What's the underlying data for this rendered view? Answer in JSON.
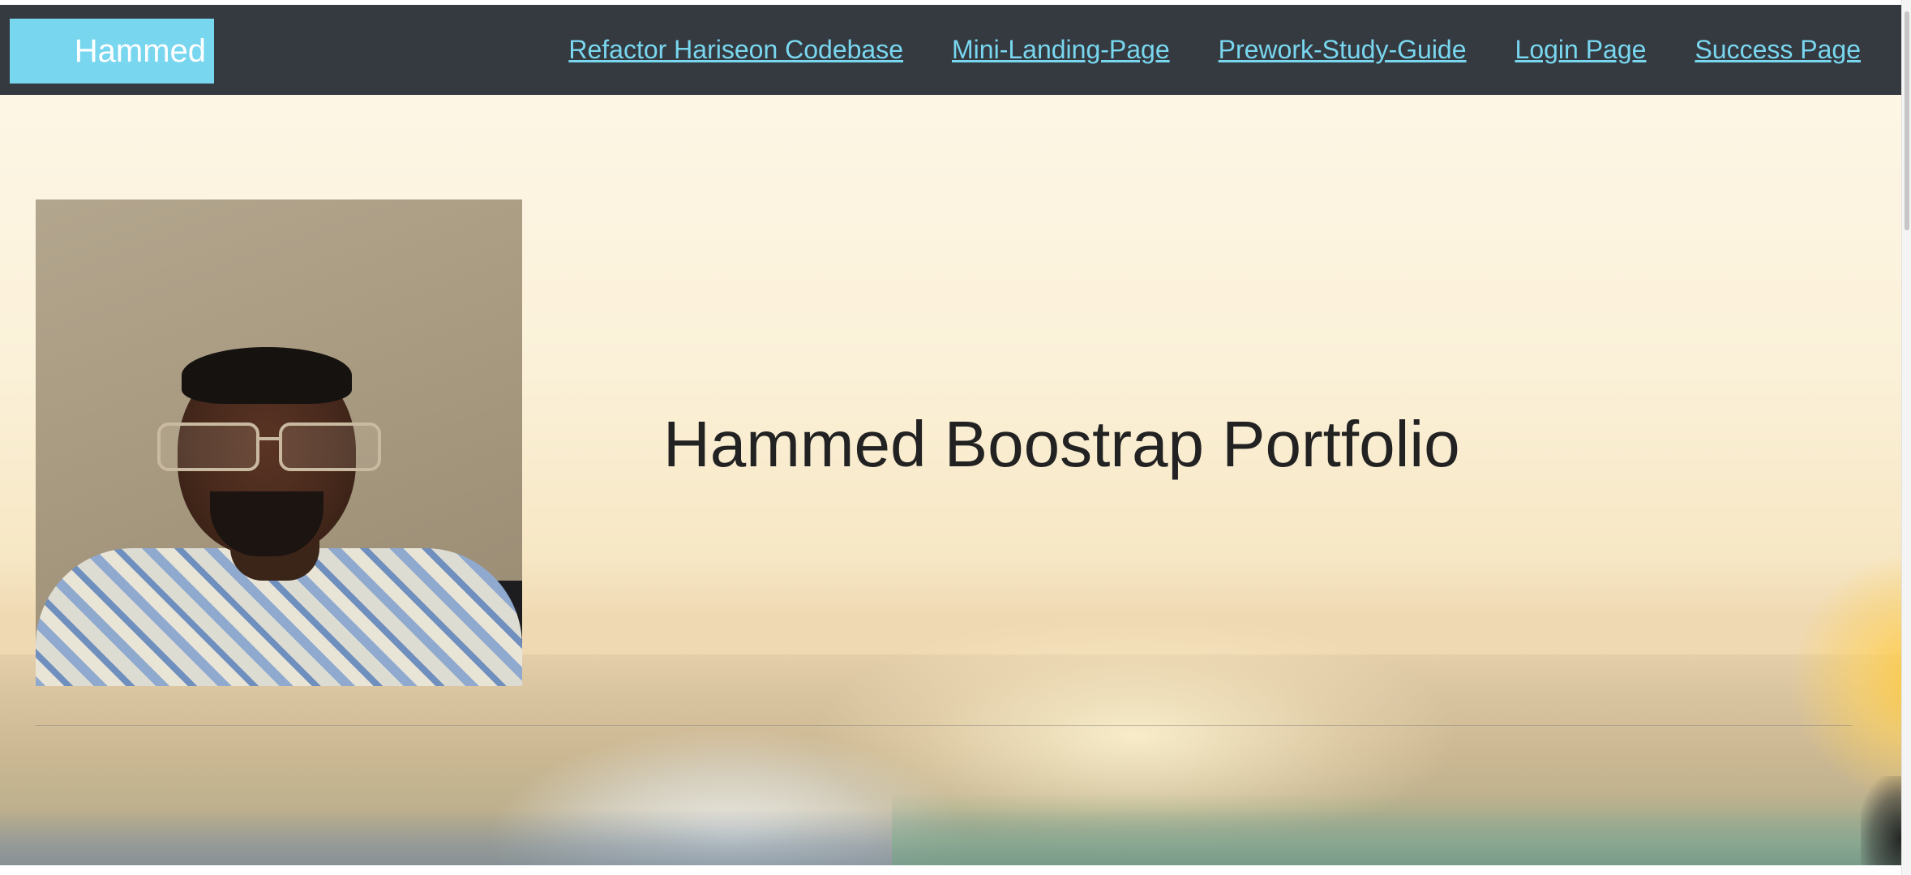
{
  "navbar": {
    "brand": "Hammed",
    "links": [
      {
        "label": "Refactor Hariseon Codebase"
      },
      {
        "label": "Mini-Landing-Page"
      },
      {
        "label": "Prework-Study-Guide"
      },
      {
        "label": "Login Page"
      },
      {
        "label": "Success Page"
      }
    ],
    "background": "#343a40",
    "link_color": "#79d6ef",
    "brand_background": "#79d6ef"
  },
  "hero": {
    "title": "Hammed Boostrap Portfolio",
    "title_color": "#222222"
  },
  "photo": {
    "description_icon": "profile-photo"
  }
}
